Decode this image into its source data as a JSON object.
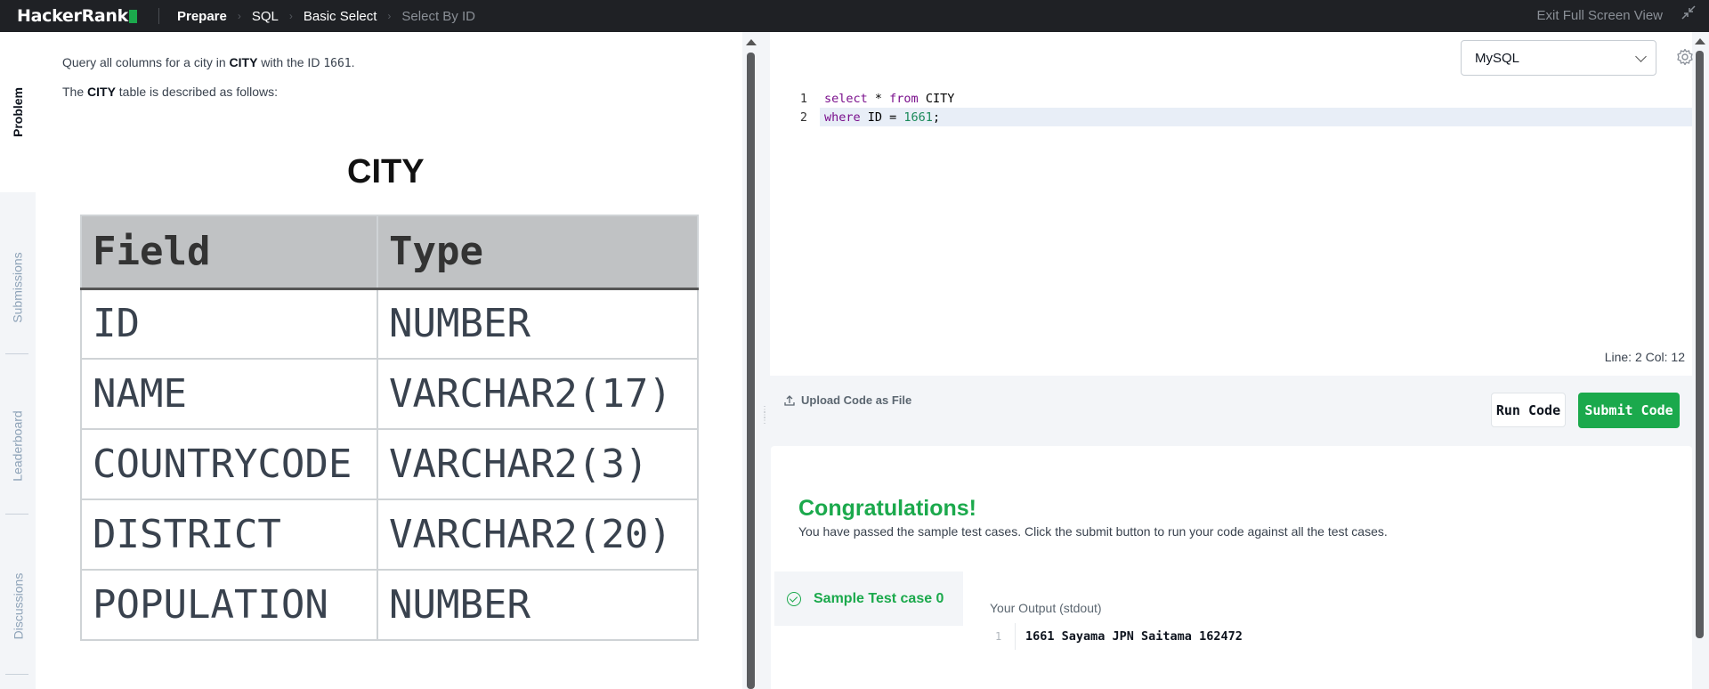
{
  "topbar": {
    "logo": "HackerRank",
    "breadcrumbs": [
      "Prepare",
      "SQL",
      "Basic Select",
      "Select By ID"
    ],
    "exit_label": "Exit Full Screen View"
  },
  "side_tabs": [
    "Problem",
    "Submissions",
    "Leaderboard",
    "Discussions"
  ],
  "problem": {
    "line1_pre": "Query all columns for a city in ",
    "line1_bold": "CITY",
    "line1_mid": " with the ID ",
    "line1_code": "1661",
    "line1_post": ".",
    "line2_pre": "The ",
    "line2_bold": "CITY",
    "line2_post": " table is described as follows:",
    "table_title": "CITY",
    "table_headers": [
      "Field",
      "Type"
    ],
    "table_rows": [
      [
        "ID",
        "NUMBER"
      ],
      [
        "NAME",
        "VARCHAR2(17)"
      ],
      [
        "COUNTRYCODE",
        "VARCHAR2(3)"
      ],
      [
        "DISTRICT",
        "VARCHAR2(20)"
      ],
      [
        "POPULATION",
        "NUMBER"
      ]
    ]
  },
  "editor": {
    "language": "MySQL",
    "lines": [
      {
        "num": "1",
        "tokens": [
          {
            "t": "select",
            "c": "kw"
          },
          {
            "t": " * ",
            "c": ""
          },
          {
            "t": "from",
            "c": "kw"
          },
          {
            "t": " CITY",
            "c": ""
          }
        ]
      },
      {
        "num": "2",
        "tokens": [
          {
            "t": "where",
            "c": "kw"
          },
          {
            "t": " ID = ",
            "c": ""
          },
          {
            "t": "1661",
            "c": "num"
          },
          {
            "t": ";",
            "c": ""
          }
        ]
      }
    ],
    "status": "Line: 2 Col: 12"
  },
  "actions": {
    "upload": "Upload Code as File",
    "run": "Run Code",
    "submit": "Submit Code"
  },
  "result": {
    "title": "Congratulations!",
    "subtitle": "You have passed the sample test cases. Click the submit button to run your code against all the test cases.",
    "test_case": "Sample Test case 0",
    "output_label": "Your Output (stdout)",
    "output_line_num": "1",
    "output_text": "1661 Sayama JPN Saitama 162472"
  },
  "colors": {
    "accent_green": "#1ba94c",
    "topbar_bg": "#1f2125"
  },
  "icons": [
    "gear-icon",
    "upload-icon",
    "check-circle-icon",
    "collapse-icon",
    "chevron-down-icon"
  ]
}
